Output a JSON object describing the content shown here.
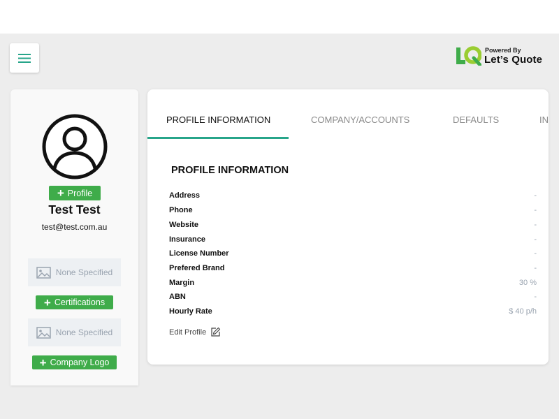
{
  "brand": {
    "powered_by": "Powered By",
    "name": "Let’s Quote",
    "logo_letters": "LQ",
    "green": "#3fac4a",
    "lime": "#9acd32"
  },
  "sidebar": {
    "add_profile_label": "Profile",
    "name": "Test Test",
    "email": "test@test.com.au",
    "certifications_placeholder": "None Specified",
    "certifications_label": "Certifications",
    "company_logo_placeholder": "None Specified",
    "company_logo_label": "Company Logo"
  },
  "tabs": [
    {
      "label": "PROFILE INFORMATION",
      "active": true
    },
    {
      "label": "COMPANY/ACCOUNTS",
      "active": false
    },
    {
      "label": "DEFAULTS",
      "active": false
    },
    {
      "label": "IN",
      "active": false
    }
  ],
  "profile": {
    "section_title": "PROFILE INFORMATION",
    "rows": [
      {
        "label": "Address",
        "value": "-"
      },
      {
        "label": "Phone",
        "value": "-"
      },
      {
        "label": "Website",
        "value": "-"
      },
      {
        "label": "Insurance",
        "value": "-"
      },
      {
        "label": "License Number",
        "value": "-"
      },
      {
        "label": "Prefered Brand",
        "value": "-"
      },
      {
        "label": "Margin",
        "value": "30 %"
      },
      {
        "label": "ABN",
        "value": "-"
      },
      {
        "label": "Hourly Rate",
        "value": "$ 40 p/h"
      }
    ],
    "edit_label": "Edit Profile"
  },
  "colors": {
    "accent_teal": "#27a58a",
    "button_green": "#3fac4a",
    "muted_text": "#9aa4b0"
  }
}
